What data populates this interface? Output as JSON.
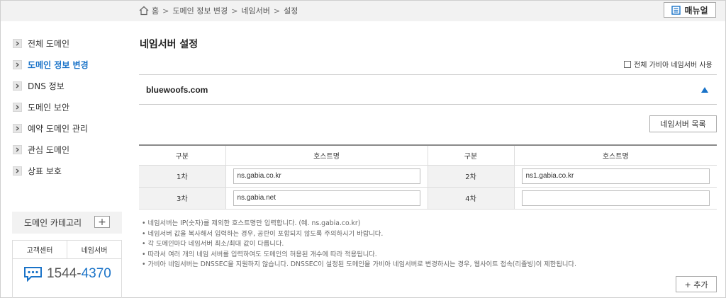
{
  "breadcrumb": {
    "items": [
      "홈",
      "도메인 정보 변경",
      "네임서버",
      "설정"
    ],
    "sep": ">"
  },
  "manual_button": "매뉴얼",
  "sidebar": {
    "items": [
      {
        "label": "전체 도메인",
        "active": false
      },
      {
        "label": "도메인 정보 변경",
        "active": true
      },
      {
        "label": "DNS 정보",
        "active": false
      },
      {
        "label": "도메인 보안",
        "active": false
      },
      {
        "label": "예약 도메인 관리",
        "active": false
      },
      {
        "label": "관심 도메인",
        "active": false
      },
      {
        "label": "상표 보호",
        "active": false
      }
    ],
    "category_label": "도메인 카테고리",
    "category_add": "+",
    "support_tabs": [
      "고객센터",
      "네임서버"
    ],
    "phone_prefix": "1544-",
    "phone_suffix": "4370"
  },
  "main": {
    "title": "네임서버 설정",
    "all_gabia_label": "전체 가비아 네임서버 사용",
    "domain": "bluewoofs.com",
    "ns_list_button": "네임서버 목록",
    "table": {
      "headers": [
        "구분",
        "호스트명",
        "구분",
        "호스트명"
      ],
      "rows": [
        {
          "l1": "1차",
          "v1": "ns.gabia.co.kr",
          "l2": "2차",
          "v2": "ns1.gabia.co.kr"
        },
        {
          "l1": "3차",
          "v1": "ns.gabia.net",
          "l2": "4차",
          "v2": ""
        }
      ]
    },
    "notes": [
      "네임서버는 IP(숫자)를 제외한 호스트명만 입력합니다. (예. ns.gabia.co.kr)",
      "네임서버 값을 복사해서 입력하는 경우, 공란이 포함되지 않도록 주의하시기 바랍니다.",
      "각 도메인마다 네임서버 최소/최대 값이 다릅니다.",
      "따라서 여러 개의 네임 서버를 입력하여도 도메인의 허용된 개수에 따라 적용됩니다.",
      "가비아 네임서버는 DNSSEC을 지원하지 않습니다. DNSSEC이 설정된 도메인을 가비아 네임서버로 변경하시는 경우, 웹사이트 접속(리졸빙)이 제한됩니다."
    ],
    "add_button": "+ 추가"
  },
  "colors": {
    "accent": "#1a73c8",
    "topbar": "#f2f2f2"
  }
}
